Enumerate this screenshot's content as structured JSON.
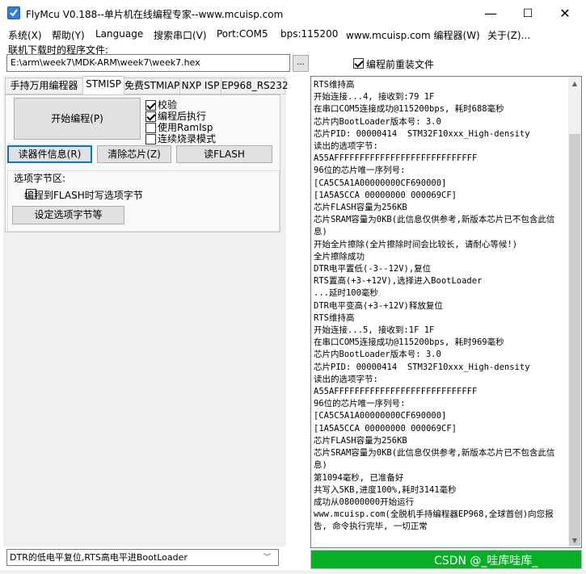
{
  "window": {
    "title": "FlyMcu V0.188--单片机在线编程专家--www.mcuisp.com",
    "minimize": "—",
    "maximize": "☐",
    "close": "✕"
  },
  "menu": [
    "系统(X)",
    "帮助(Y)",
    "Language",
    "搜索串口(V)",
    "Port:COM5",
    "bps:115200",
    "www.mcuisp.com 编程器(W)",
    "关于(Z)..."
  ],
  "file": {
    "label": "联机下载时的程序文件:",
    "path": "E:\\arm\\week7\\MDK-ARM\\week7\\week7.hex",
    "browse": "...",
    "reload_label": "编程前重装文件",
    "reload_checked": true
  },
  "tabs": [
    {
      "label": "手持万用编程器",
      "active": false
    },
    {
      "label": "STMISP",
      "active": true
    },
    {
      "label": "免费STMIAP",
      "active": false
    },
    {
      "label": "NXP ISP",
      "active": false
    },
    {
      "label": "EP968_RS232",
      "active": false
    }
  ],
  "stmisp": {
    "start_button": "开始编程(P)",
    "options": [
      {
        "label": "校验",
        "checked": true
      },
      {
        "label": "编程后执行",
        "checked": true
      },
      {
        "label": "使用RamIsp",
        "checked": false
      },
      {
        "label": "连续烧录模式",
        "checked": false
      }
    ],
    "read_info_button": "读器件信息(R)",
    "clear_chip_button": "清除芯片(Z)",
    "read_flash_button": "读FLASH",
    "option_bytes": {
      "title": "选项字节区:",
      "write_label": "编程到FLASH时写选项字节",
      "write_checked": false,
      "set_button": "设定选项字节等"
    }
  },
  "dtr_select": {
    "value": "DTR的低电平复位,RTS高电平进BootLoader",
    "arrow": "﹀"
  },
  "log": {
    "text": "RTS维持高\n开始连接...4, 接收到:79 1F\n在串口COM5连接成功@115200bps, 耗时688毫秒\n芯片内BootLoader版本号: 3.0\n芯片PID: 00000414  STM32F10xxx_High-density\n读出的选项字节:\nA55AFFFFFFFFFFFFFFFFFFFFFFFFFFFF\n96位的芯片唯一序列号:\n[CA5C5A1A00000000CF690000]\n[1A5A5CCA 00000000 000069CF]\n芯片FLASH容量为256KB\n芯片SRAM容量为0KB(此信息仅供参考,新版本芯片已不包含此信息)\n开始全片擦除(全片擦除时间会比较长, 请耐心等候!)\n全片擦除成功\nDTR电平置低(-3--12V),复位\nRTS置高(+3-+12V),选择进入BootLoader\n...延时100毫秒\nDTR电平变高(+3-+12V)释放复位\nRTS维持高\n开始连接...5, 接收到:1F 1F\n在串口COM5连接成功@115200bps, 耗时969毫秒\n芯片内BootLoader版本号: 3.0\n芯片PID: 00000414  STM32F10xxx_High-density\n读出的选项字节:\nA55AFFFFFFFFFFFFFFFFFFFFFFFFFFFF\n96位的芯片唯一序列号:\n[CA5C5A1A00000000CF690000]\n[1A5A5CCA 00000000 000069CF]\n芯片FLASH容量为256KB\n芯片SRAM容量为0KB(此信息仅供参考,新版本芯片已不包含此信息)\n第1094毫秒, 已准备好\n共写入5KB,进度100%,耗时3141毫秒\n成功从08000000开始运行\nwww.mcuisp.com(全脱机手持编程器EP968,全球首创)向您报告, 命令执行完毕, 一切正常",
    "scroll_up": "▲",
    "scroll_down": "▼"
  },
  "progress": {
    "fraction": 1.0,
    "color": "#06b025"
  },
  "watermark": "CSDN @_哇库哇库_"
}
